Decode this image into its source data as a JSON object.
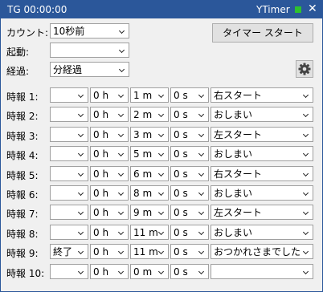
{
  "titlebar": {
    "title": "TG 00:00:00",
    "app_name": "YTimer",
    "close_glyph": "✕",
    "status_color": "#2ec12e"
  },
  "controls": {
    "count_label": "カウント:",
    "count_value": "10秒前",
    "launch_label": "起動:",
    "launch_value": "",
    "elapsed_label": "経過:",
    "elapsed_value": "分経過",
    "start_button": "タイマー スタート",
    "settings_icon": "gear-icon"
  },
  "alarms": [
    {
      "label": "時報 1:",
      "mode": "",
      "hours": "0 h",
      "minutes": "1 m",
      "seconds": "0 s",
      "message": "右スタート"
    },
    {
      "label": "時報 2:",
      "mode": "",
      "hours": "0 h",
      "minutes": "2 m",
      "seconds": "0 s",
      "message": "おしまい"
    },
    {
      "label": "時報 3:",
      "mode": "",
      "hours": "0 h",
      "minutes": "3 m",
      "seconds": "0 s",
      "message": "左スタート"
    },
    {
      "label": "時報 4:",
      "mode": "",
      "hours": "0 h",
      "minutes": "5 m",
      "seconds": "0 s",
      "message": "おしまい"
    },
    {
      "label": "時報 5:",
      "mode": "",
      "hours": "0 h",
      "minutes": "6 m",
      "seconds": "0 s",
      "message": "右スタート"
    },
    {
      "label": "時報 6:",
      "mode": "",
      "hours": "0 h",
      "minutes": "8 m",
      "seconds": "0 s",
      "message": "おしまい"
    },
    {
      "label": "時報 7:",
      "mode": "",
      "hours": "0 h",
      "minutes": "9 m",
      "seconds": "0 s",
      "message": "左スタート"
    },
    {
      "label": "時報 8:",
      "mode": "",
      "hours": "0 h",
      "minutes": "11 m",
      "seconds": "0 s",
      "message": "おしまい"
    },
    {
      "label": "時報 9:",
      "mode": "終了",
      "hours": "0 h",
      "minutes": "11 m",
      "seconds": "0 s",
      "message": "おつかれさまでした"
    },
    {
      "label": "時報 10:",
      "mode": "",
      "hours": "0 h",
      "minutes": "0 m",
      "seconds": "0 s",
      "message": ""
    }
  ]
}
